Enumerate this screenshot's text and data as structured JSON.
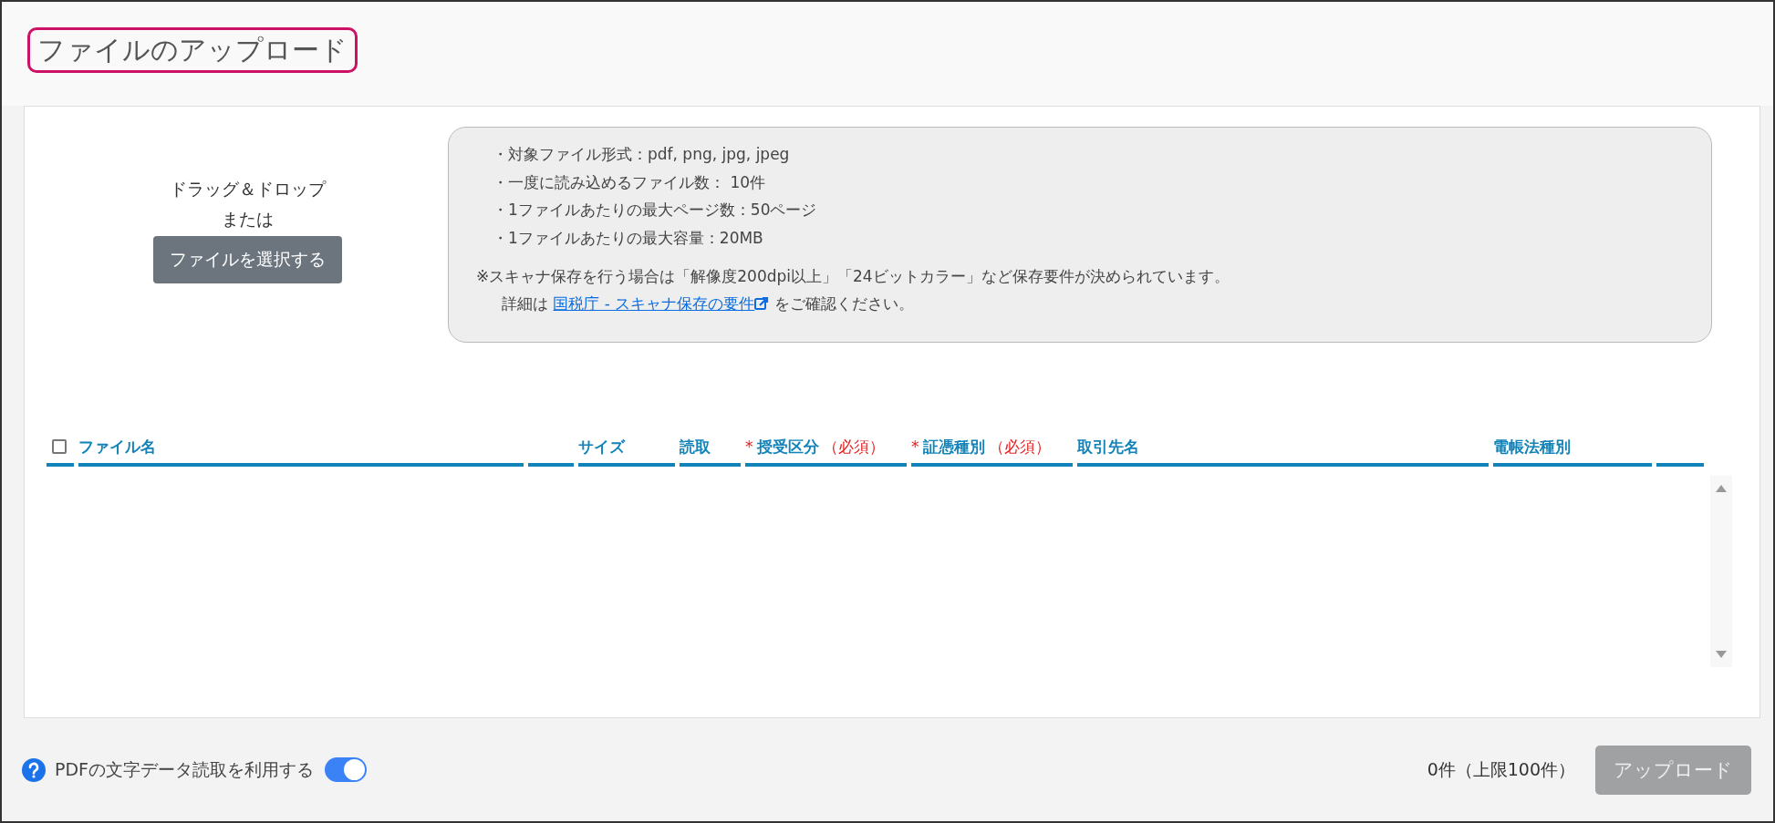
{
  "title": "ファイルのアップロード",
  "dropzone": {
    "line_1": "ドラッグ＆ドロップ",
    "line_2": "または",
    "button": "ファイルを選択する"
  },
  "info": {
    "bullets": [
      "・対象ファイル形式：pdf, png, jpg, jpeg",
      "・一度に読み込めるファイル数： 10件",
      "・1ファイルあたりの最大ページ数：50ページ",
      "・1ファイルあたりの最大容量：20MB"
    ],
    "note": "※スキャナ保存を行う場合は「解像度200dpi以上」「24ビットカラー」など保存要件が決められています。",
    "detail_prefix": "詳細は",
    "link": "国税庁 - スキャナ保存の要件",
    "detail_suffix": "をご確認ください。"
  },
  "table": {
    "select_all": {
      "checked": false
    },
    "columns": [
      {
        "label": "ファイル名"
      },
      {
        "label": "サイズ"
      },
      {
        "label": "読取"
      },
      {
        "label": "授受区分",
        "required_mark": "*",
        "required_note": "（必須）"
      },
      {
        "label": "証憑種別",
        "required_mark": "*",
        "required_note": "（必須）"
      },
      {
        "label": "取引先名"
      },
      {
        "label": "電帳法種別"
      }
    ]
  },
  "footer": {
    "ocr_toggle": {
      "label": "PDFの文字データ読取を利用する",
      "on": true
    },
    "count": "0件（上限100件）",
    "upload_button": {
      "label": "アップロード",
      "disabled": true
    }
  }
}
